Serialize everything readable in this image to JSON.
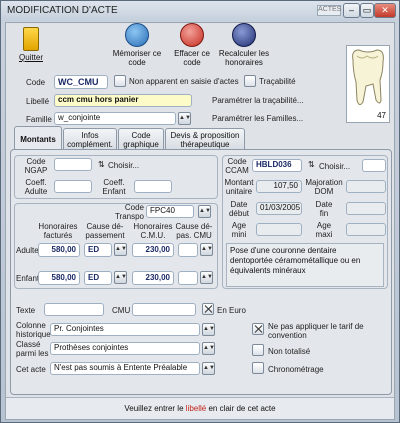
{
  "window": {
    "title": "MODIFICATION D'ACTE",
    "sizebox": "ACTES",
    "minimize": "–",
    "maximize": "▭",
    "close": "✕"
  },
  "toolbar": {
    "quit": "Quitter",
    "memorize_l1": "Mémoriser ce",
    "memorize_l2": "code",
    "delete_l1": "Effacer ce",
    "delete_l2": "code",
    "recalc_l1": "Recalculer les",
    "recalc_l2": "honoraires"
  },
  "colors": {
    "memorize": "#3b83c7",
    "delete": "#d5352c",
    "recalc": "#2c3e8a",
    "status_red": "#c0231a"
  },
  "tooth": {
    "number": "47"
  },
  "header": {
    "code_label": "Code",
    "code_value": "WC_CMU",
    "non_apparent": "Non apparent en saisie d'actes",
    "tracabilite": "Traçabilité",
    "libelle_label": "Libellé",
    "libelle_value": "ccm cmu hors panier",
    "param_trac": "Paramétrer la traçabilité...",
    "famille_label": "Famille",
    "famille_value": "w_conjointe",
    "param_fam": "Paramétrer les Familles..."
  },
  "tabs": [
    {
      "label": "Montants"
    },
    {
      "label_l1": "Infos",
      "label_l2": "complément."
    },
    {
      "label_l1": "Code",
      "label_l2": "graphique"
    },
    {
      "label_l1": "Devis & proposition",
      "label_l2": "thérapeutique"
    }
  ],
  "ngap": {
    "code_l1": "Code",
    "code_l2": "NGAP",
    "code_value": "",
    "choisir": "Choisir...",
    "coeff_adulte_l1": "Coeff.",
    "coeff_adulte_l2": "Adulte",
    "coeff_enfant_l1": "Coeff.",
    "coeff_enfant_l2": "Enfant"
  },
  "ccam": {
    "code_l1": "Code",
    "code_l2": "CCAM",
    "code_value": "HBLD036",
    "choisir": "Choisir...",
    "montant_l1": "Montant",
    "montant_l2": "unitaire",
    "montant_value": "107,50",
    "majoration_l1": "Majoration",
    "majoration_l2": "DOM",
    "date_debut_l1": "Date",
    "date_debut_l2": "début",
    "date_debut_value": "01/03/2005",
    "date_fin_l1": "Date",
    "date_fin_l2": "fin",
    "age_mini_l1": "Age",
    "age_mini_l2": "mini",
    "age_maxi_l1": "Age",
    "age_maxi_l2": "maxi",
    "description": "Pose d'une couronne dentaire dentoportée céramométallique ou en équivalents minéraux"
  },
  "honoraires": {
    "code_transpo_l1": "Code",
    "code_transpo_l2": "Transpo",
    "code_transpo_value": "FPC40",
    "col_hon_l1": "Honoraires",
    "col_hon_l2": "facturés",
    "col_cause_l1": "Cause dé-",
    "col_cause_l2": "passement",
    "col_cmu_l1": "Honoraires",
    "col_cmu_l2": "C.M.U.",
    "col_cause_cmu_l1": "Cause dé-",
    "col_cause_cmu_l2": "pas. CMU",
    "rows": [
      {
        "label": "Adulte",
        "honoraires": "580,00",
        "cause": "ED",
        "cmu": "230,00",
        "cause_cmu": ""
      },
      {
        "label": "Enfant",
        "honoraires": "580,00",
        "cause": "ED",
        "cmu": "230,00",
        "cause_cmu": ""
      }
    ]
  },
  "bottom": {
    "texte_label": "Texte",
    "texte_value": "",
    "cmu_label": "CMU",
    "cmu_value": "",
    "en_euro": "En Euro",
    "colonne_l1": "Colonne",
    "colonne_l2": "historique",
    "colonne_value": "Pr. Conjointes",
    "classe_l1": "Classé",
    "classe_l2": "parmi les",
    "classe_value": "Prothèses conjointes",
    "cetacte_label": "Cet acte",
    "cetacte_value": "N'est pas soumis à Entente Préalable",
    "ne_pas_l1": "Ne pas appliquer le tarif de",
    "ne_pas_l2": "convention",
    "non_totalise": "Non totalisé",
    "chrono": "Chronométrage"
  },
  "status": {
    "before": "Veuillez entrer le ",
    "red": "libellé",
    "after": " en clair de cet acte"
  }
}
